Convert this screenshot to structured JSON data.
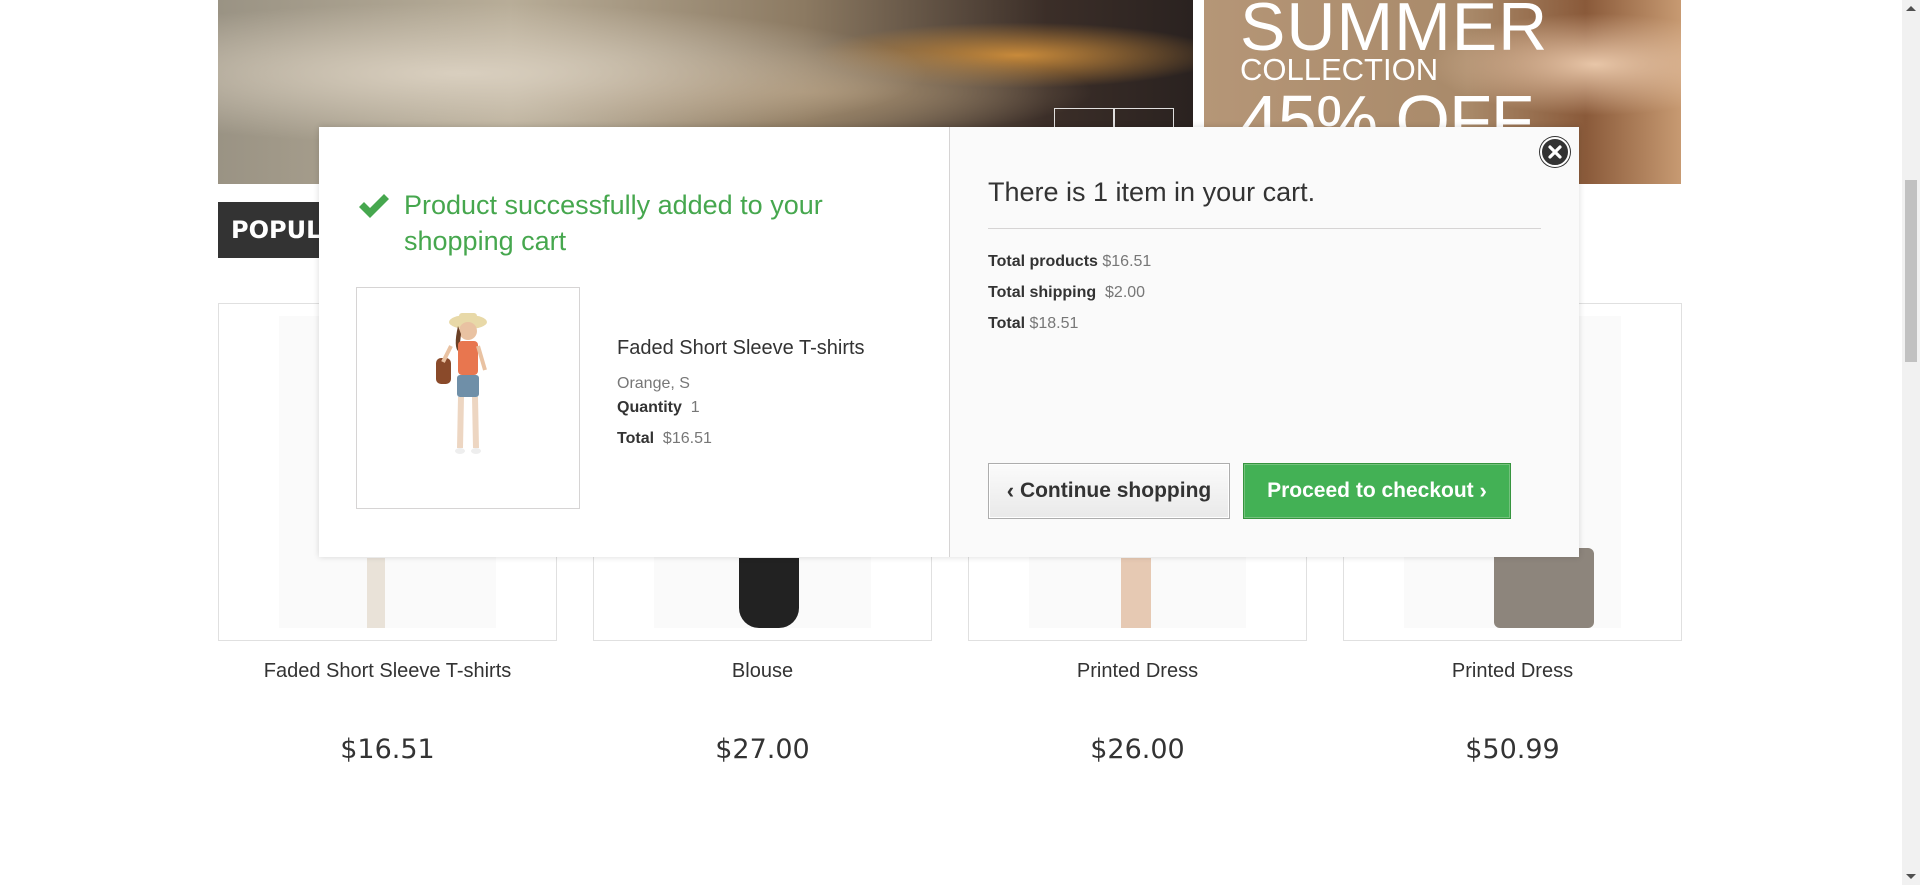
{
  "promo": {
    "line1": "SUMMER",
    "line2": "COLLECTION",
    "line3": "45% OFF"
  },
  "section": {
    "tab_label": "POPULAR"
  },
  "products": [
    {
      "name": "Faded Short Sleeve T-shirts",
      "price": "$16.51"
    },
    {
      "name": "Blouse",
      "price": "$27.00"
    },
    {
      "name": "Printed Dress",
      "price": "$26.00"
    },
    {
      "name": "Printed Dress",
      "price": "$50.99"
    }
  ],
  "modal": {
    "success_message": "Product successfully added to your shopping cart",
    "product": {
      "name": "Faded Short Sleeve T-shirts",
      "attributes": "Orange, S",
      "quantity_label": "Quantity",
      "quantity": "1",
      "total_label": "Total",
      "total": "$16.51"
    },
    "cart": {
      "count_text": "There is 1 item in your cart.",
      "total_products_label": "Total products",
      "total_products": "$16.51",
      "total_shipping_label": "Total shipping",
      "total_shipping": "$2.00",
      "total_label": "Total",
      "total": "$18.51"
    },
    "buttons": {
      "continue": "Continue shopping",
      "checkout": "Proceed to checkout"
    }
  },
  "colors": {
    "success_green": "#46a74e",
    "checkout_button": "#43b155",
    "tab_dark": "#333333"
  }
}
